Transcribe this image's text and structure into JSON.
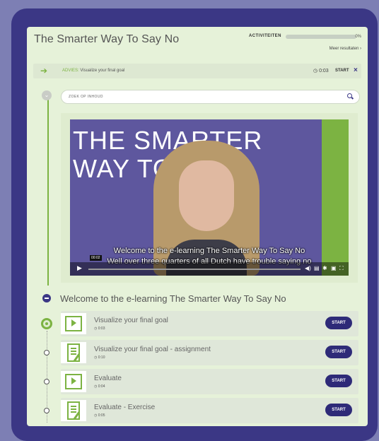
{
  "course": {
    "title": "The Smarter Way To Say No",
    "activity_label": "ACTIVITEITEN",
    "activity_progress": 0,
    "activity_percent": "0%",
    "more_results": "Meer resultaten"
  },
  "advice": {
    "prefix": "ADVIES:",
    "text": "Visualize your final goal",
    "time": "0:03",
    "start": "START",
    "close": "×"
  },
  "search": {
    "placeholder": "ZOEK OP INHOUD"
  },
  "video": {
    "overlay_title": "THE SMARTER WAY TO",
    "subtitle_line1": "Welcome to the e-learning The Smarter Way To Say No",
    "subtitle_line2": "Well over three quarters of all Dutch have trouble saying no",
    "time": "00:02"
  },
  "section": {
    "title": "Welcome to the e-learning The Smarter Way To Say No"
  },
  "lessons": [
    {
      "title": "Visualize your final goal",
      "duration": "0:03",
      "type": "video",
      "start": "START"
    },
    {
      "title": "Visualize your final goal - assignment",
      "duration": "0:10",
      "type": "assignment",
      "start": "START"
    },
    {
      "title": "Evaluate",
      "duration": "0:04",
      "type": "video",
      "start": "START"
    },
    {
      "title": "Evaluate - Exercise",
      "duration": "0:05",
      "type": "assignment",
      "start": "START"
    }
  ],
  "colors": {
    "accent": "#3b3785",
    "green": "#7cb342",
    "card_bg": "#e6f2d9"
  }
}
